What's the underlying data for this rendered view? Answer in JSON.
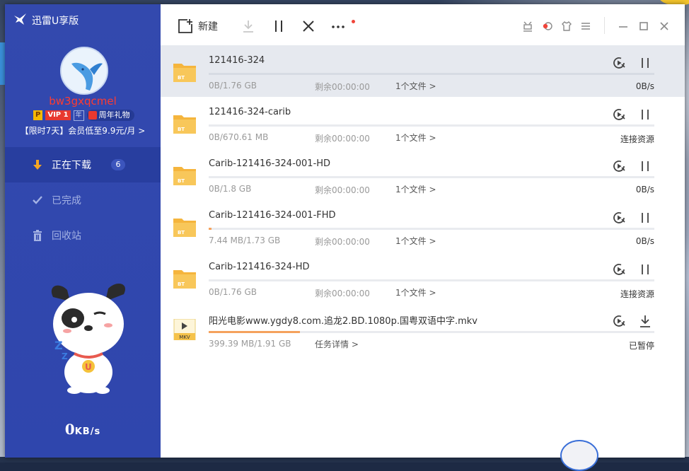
{
  "app": {
    "title": "迅雷U享版"
  },
  "user": {
    "name": "bw3gxqcmel",
    "badge_p": "P",
    "badge_vip": "VIP 1",
    "badge_year": "年",
    "gift_label": "周年礼物",
    "promo": "【限时7天】会员低至9.9元/月 >"
  },
  "nav": [
    {
      "label": "正在下载",
      "count": "6",
      "icon": "download-arrow-icon"
    },
    {
      "label": "已完成",
      "icon": "check-icon"
    },
    {
      "label": "回收站",
      "icon": "trash-icon"
    }
  ],
  "speed": {
    "value": "0",
    "unit": "KB/s"
  },
  "toolbar": {
    "new_label": "新建"
  },
  "tasks": [
    {
      "name": "121416-324",
      "type": "BT",
      "size": "0B/1.76 GB",
      "remaining": "剩余00:00:00",
      "files": "1个文件 >",
      "status": "0B/s",
      "progress": 0,
      "action": "pause"
    },
    {
      "name": "121416-324-carib",
      "type": "BT",
      "size": "0B/670.61 MB",
      "remaining": "剩余00:00:00",
      "files": "1个文件 >",
      "status": "连接资源",
      "progress": 0,
      "action": "pause"
    },
    {
      "name": "Carib-121416-324-001-HD",
      "type": "BT",
      "size": "0B/1.8 GB",
      "remaining": "剩余00:00:00",
      "files": "1个文件 >",
      "status": "0B/s",
      "progress": 0,
      "action": "pause"
    },
    {
      "name": "Carib-121416-324-001-FHD",
      "type": "BT",
      "size": "7.44 MB/1.73 GB",
      "remaining": "剩余00:00:00",
      "files": "1个文件 >",
      "status": "0B/s",
      "progress": 0.004,
      "action": "pause"
    },
    {
      "name": "Carib-121416-324-HD",
      "type": "BT",
      "size": "0B/1.76 GB",
      "remaining": "剩余00:00:00",
      "files": "1个文件 >",
      "status": "连接资源",
      "progress": 0,
      "action": "pause"
    },
    {
      "name": "阳光电影www.ygdy8.com.追龙2.BD.1080p.国粤双语中字.mkv",
      "type": "MKV",
      "size": "399.39 MB/1.91 GB",
      "remaining": "",
      "files": "任务详情 >",
      "status": "已暂停",
      "progress": 0.204,
      "action": "download"
    }
  ],
  "colors": {
    "sidebar": "#3349ae",
    "accent_orange": "#f5a25d",
    "username_red": "#ff3b30"
  }
}
